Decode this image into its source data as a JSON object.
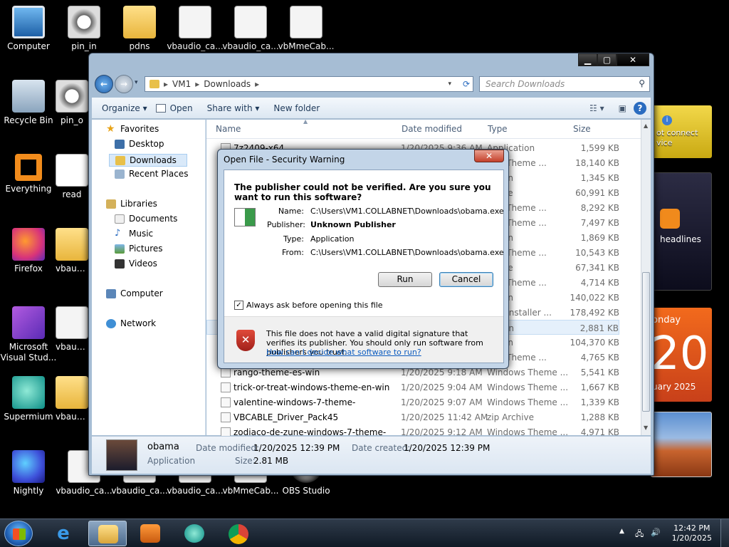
{
  "desktop": {
    "icons": [
      {
        "label": "Computer",
        "icon": "computer-icon"
      },
      {
        "label": "pin_in",
        "icon": "media-file-icon"
      },
      {
        "label": "pdns",
        "icon": "folder-icon"
      },
      {
        "label": "vbaudio_ca...",
        "icon": "setup-file-icon"
      },
      {
        "label": "vbaudio_ca...",
        "icon": "setup-file-icon"
      },
      {
        "label": "vbMmeCab...",
        "icon": "setup-file-icon"
      },
      {
        "label": "Recycle Bin",
        "icon": "recycle-bin-icon"
      },
      {
        "label": "pin_o",
        "icon": "media-file-icon"
      },
      {
        "label": "Everything",
        "icon": "everything-icon"
      },
      {
        "label": "read",
        "icon": "text-file-icon"
      },
      {
        "label": "Firefox",
        "icon": "firefox-icon"
      },
      {
        "label": "vbaudio",
        "icon": "setup-file-icon"
      },
      {
        "label": "Microsoft Visual Stud...",
        "icon": "visual-studio-icon"
      },
      {
        "label": "vbaudio",
        "icon": "setup-file-icon"
      },
      {
        "label": "Supermium",
        "icon": "supermium-icon"
      },
      {
        "label": "vbaudio",
        "icon": "setup-file-icon"
      },
      {
        "label": "Nightly",
        "icon": "nightly-icon"
      },
      {
        "label": "vbaudio_ca...",
        "icon": "setup-file-icon"
      },
      {
        "label": "vbaudio_ca...",
        "icon": "setup-file-icon"
      },
      {
        "label": "vbaudio_ca...",
        "icon": "setup-file-icon"
      },
      {
        "label": "vbMmeCab...",
        "icon": "setup-file-icon"
      },
      {
        "label": "OBS Studio",
        "icon": "obs-icon"
      }
    ]
  },
  "gadgets": {
    "weather_text": "ot connect\nvice",
    "feed_text": "headlines",
    "calendar_day": "onday",
    "calendar_date": "20",
    "calendar_month": "uary 2025"
  },
  "explorer": {
    "breadcrumb": [
      "VM1",
      "Downloads"
    ],
    "search_placeholder": "Search Downloads",
    "toolbar": {
      "organize": "Organize ▾",
      "open": "Open",
      "share": "Share with ▾",
      "new_folder": "New folder"
    },
    "nav": {
      "favorites": "Favorites",
      "desktop": "Desktop",
      "downloads": "Downloads",
      "recent": "Recent Places",
      "libraries": "Libraries",
      "documents": "Documents",
      "music": "Music",
      "pictures": "Pictures",
      "videos": "Videos",
      "computer": "Computer",
      "network": "Network"
    },
    "columns": {
      "name": "Name",
      "date": "Date modified",
      "type": "Type",
      "size": "Size"
    },
    "rows": [
      {
        "name": "7z2409-x64",
        "date": "1/20/2025 9:36 AM",
        "type": "Application",
        "size": "1,599 KB"
      },
      {
        "name": "",
        "date": "",
        "type": "ows Theme ...",
        "size": "18,140 KB"
      },
      {
        "name": "",
        "date": "",
        "type": "cation",
        "size": "1,345 KB"
      },
      {
        "name": "",
        "date": "",
        "type": "rchive",
        "size": "60,991 KB"
      },
      {
        "name": "",
        "date": "",
        "type": "ows Theme ...",
        "size": "8,292 KB"
      },
      {
        "name": "",
        "date": "",
        "type": "ows Theme ...",
        "size": "7,497 KB"
      },
      {
        "name": "",
        "date": "",
        "type": "cation",
        "size": "1,869 KB"
      },
      {
        "name": "",
        "date": "",
        "type": "ows Theme ...",
        "size": "10,543 KB"
      },
      {
        "name": "",
        "date": "",
        "type": "rchive",
        "size": "67,341 KB"
      },
      {
        "name": "",
        "date": "",
        "type": "ows Theme ...",
        "size": "4,714 KB"
      },
      {
        "name": "",
        "date": "",
        "type": "cation",
        "size": "140,022 KB"
      },
      {
        "name": "",
        "date": "",
        "type": "ows Installer ...",
        "size": "178,492 KB"
      },
      {
        "name": "",
        "date": "",
        "type": "cation",
        "size": "2,881 KB"
      },
      {
        "name": "",
        "date": "",
        "type": "cation",
        "size": "104,370 KB"
      },
      {
        "name": "",
        "date": "",
        "type": "ows Theme ...",
        "size": "4,765 KB"
      },
      {
        "name": "rango-theme-es-win",
        "date": "1/20/2025 9:18 AM",
        "type": "Windows Theme ...",
        "size": "5,541 KB"
      },
      {
        "name": "trick-or-treat-windows-theme-en-win",
        "date": "1/20/2025 9:04 AM",
        "type": "Windows Theme ...",
        "size": "1,667 KB"
      },
      {
        "name": "valentine-windows-7-theme-",
        "date": "1/20/2025 9:07 AM",
        "type": "Windows Theme ...",
        "size": "1,339 KB"
      },
      {
        "name": "VBCABLE_Driver_Pack45",
        "date": "1/20/2025 11:42 AM",
        "type": "zip Archive",
        "size": "1,288 KB"
      },
      {
        "name": "zodiaco-de-zune-windows-7-theme-",
        "date": "1/20/2025 9:12 AM",
        "type": "Windows Theme ...",
        "size": "4,971 KB"
      }
    ],
    "details": {
      "name": "obama",
      "kind": "Application",
      "modified_label": "Date modified:",
      "modified": "1/20/2025 12:39 PM",
      "created_label": "Date created:",
      "created": "1/20/2025 12:39 PM",
      "size_label": "Size:",
      "size": "2.81 MB"
    }
  },
  "dialog": {
    "title": "Open File - Security Warning",
    "heading": "The publisher could not be verified.  Are you sure you want to run this software?",
    "props": [
      {
        "label": "Name:",
        "value": "C:\\Users\\VM1.COLLABNET\\Downloads\\obama.exe"
      },
      {
        "label": "Publisher:",
        "value": "Unknown Publisher"
      },
      {
        "label": "Type:",
        "value": "Application"
      },
      {
        "label": "From:",
        "value": "C:\\Users\\VM1.COLLABNET\\Downloads\\obama.exe"
      }
    ],
    "run": "Run",
    "cancel": "Cancel",
    "checkbox": "Always ask before opening this file",
    "warning": "This file does not have a valid digital signature that verifies its publisher.  You should only run software from publishers you trust.",
    "link": "How can I decide what software to run?"
  },
  "taskbar": {
    "time": "12:42 PM",
    "date": "1/20/2025"
  }
}
